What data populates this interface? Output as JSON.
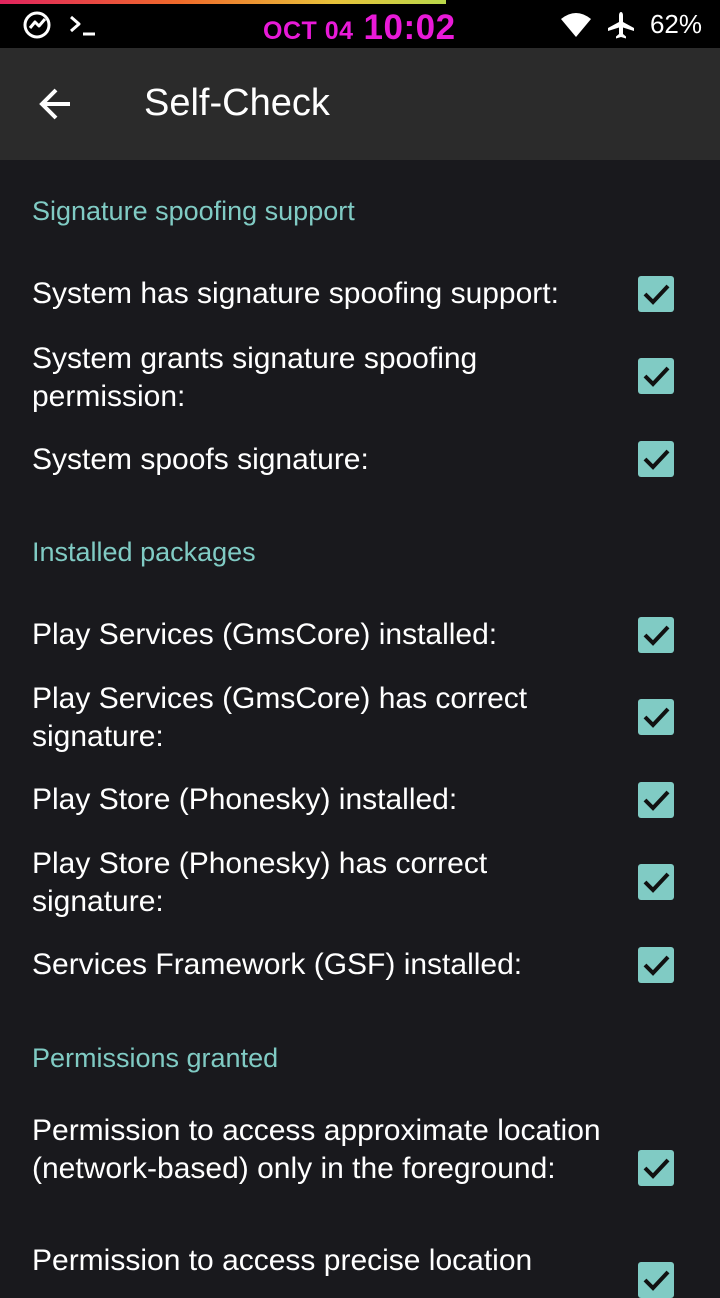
{
  "status_bar": {
    "date": "OCT 04",
    "time": "10:02",
    "battery": "62%",
    "progress_fraction": 0.62,
    "left_icons": [
      "speedometer-icon",
      "terminal-icon"
    ],
    "right_icons": [
      "wifi-icon",
      "airplane-icon"
    ]
  },
  "app_bar": {
    "back_icon": "arrow-left-icon",
    "title": "Self-Check"
  },
  "colors": {
    "accent": "#80cbc4",
    "background": "#19191d",
    "app_bar": "#2b2b2b",
    "clock": "#e91ad8"
  },
  "sections": [
    {
      "title": "Signature spoofing support",
      "items": [
        {
          "label": "System has signature spoofing support:",
          "checked": true
        },
        {
          "label": "System grants signature spoofing permission:",
          "checked": true
        },
        {
          "label": "System spoofs signature:",
          "checked": true
        }
      ]
    },
    {
      "title": "Installed packages",
      "items": [
        {
          "label": "Play Services (GmsCore) installed:",
          "checked": true
        },
        {
          "label": "Play Services (GmsCore) has correct signature:",
          "checked": true
        },
        {
          "label": "Play Store (Phonesky) installed:",
          "checked": true
        },
        {
          "label": "Play Store (Phonesky) has correct signature:",
          "checked": true
        },
        {
          "label": "Services Framework (GSF) installed:",
          "checked": true
        }
      ]
    },
    {
      "title": "Permissions granted",
      "items": [
        {
          "label": "Permission to access approximate location (network-based) only in the foreground:",
          "checked": true
        },
        {
          "label": "Permission to access precise location",
          "checked": true
        }
      ]
    }
  ]
}
